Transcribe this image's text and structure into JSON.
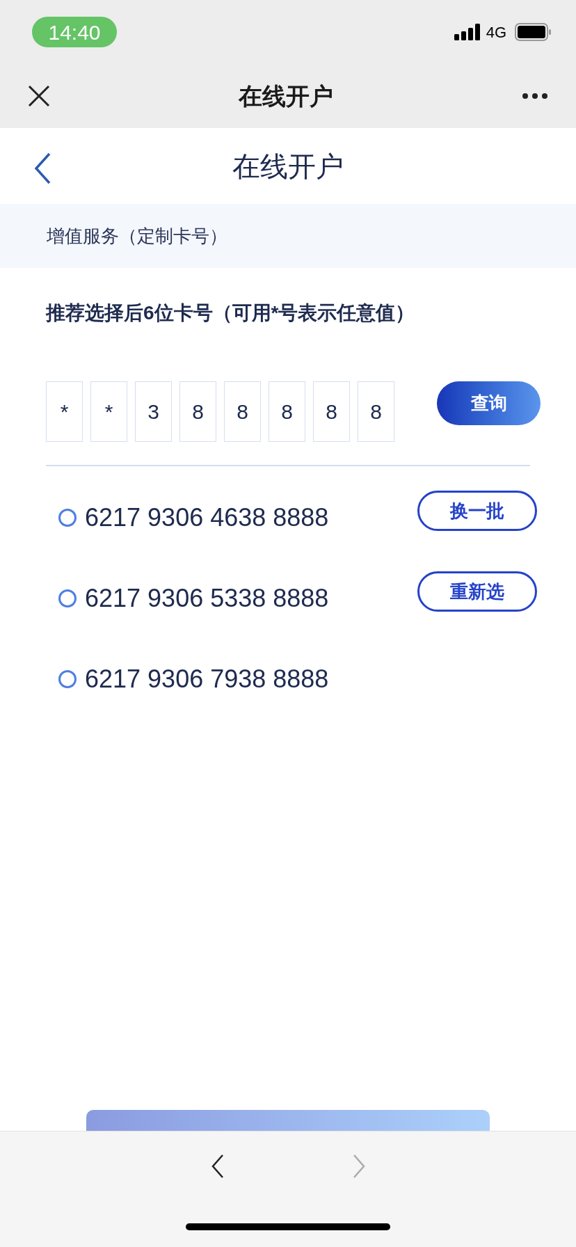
{
  "status_bar": {
    "time": "14:40",
    "network": "4G"
  },
  "nav_bar": {
    "title": "在线开户"
  },
  "header": {
    "title": "在线开户"
  },
  "section": {
    "title": "增值服务（定制卡号）"
  },
  "prompt": "推荐选择后6位卡号（可用*号表示任意值）",
  "digits": [
    "*",
    "*",
    "3",
    "8",
    "8",
    "8",
    "8",
    "8"
  ],
  "query_button": "查询",
  "numbers": [
    {
      "number": "6217 9306 4638 8888",
      "selected": false,
      "action": "换一批"
    },
    {
      "number": "6217 9306 5338 8888",
      "selected": false,
      "action": "重新选"
    },
    {
      "number": "6217 9306 7938 8888",
      "selected": false
    }
  ],
  "browser_bar": {
    "back_disabled": false,
    "forward_disabled": true
  }
}
